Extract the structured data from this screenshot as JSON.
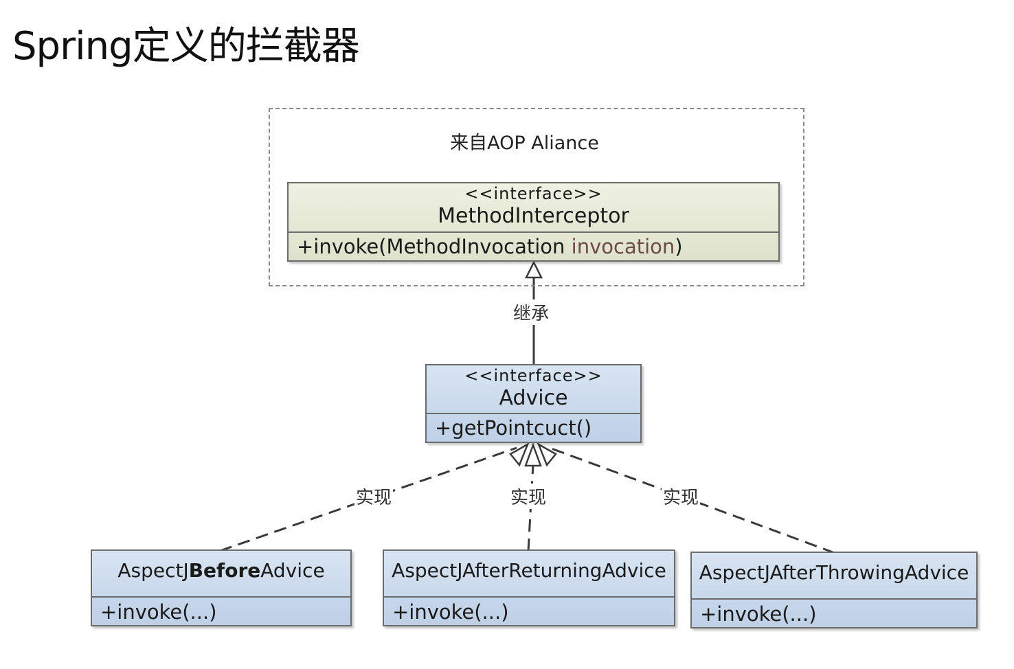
{
  "title": "Spring定义的拦截器",
  "group": {
    "label": "来自AOP Aliance"
  },
  "classes": {
    "method_interceptor": {
      "stereotype": "<<interface>>",
      "name": "MethodInterceptor",
      "member": {
        "prefix": "+invoke(MethodInvocation ",
        "param": "invocation",
        "suffix": ")"
      }
    },
    "advice": {
      "stereotype": "<<interface>>",
      "name": "Advice",
      "member": "+getPointcuct()"
    },
    "before_advice": {
      "name_prefix": "AspectJ",
      "name_bold": "Before",
      "name_suffix": "Advice",
      "member": "+invoke(...)"
    },
    "after_returning_advice": {
      "name": "AspectJAfterReturningAdvice",
      "member": "+invoke(...)"
    },
    "after_throwing_advice": {
      "name": "AspectJAfterThrowingAdvice",
      "member": "+invoke(...)"
    }
  },
  "relations": {
    "inherit": "继承",
    "implement_left": "实现",
    "implement_middle": "实现",
    "implement_right": "实现"
  },
  "colors": {
    "aop_fill": "#e6e8d4",
    "blue_fill": "#c8d8ec",
    "line": "#3a3a3a",
    "param": "#6b4a4a"
  }
}
